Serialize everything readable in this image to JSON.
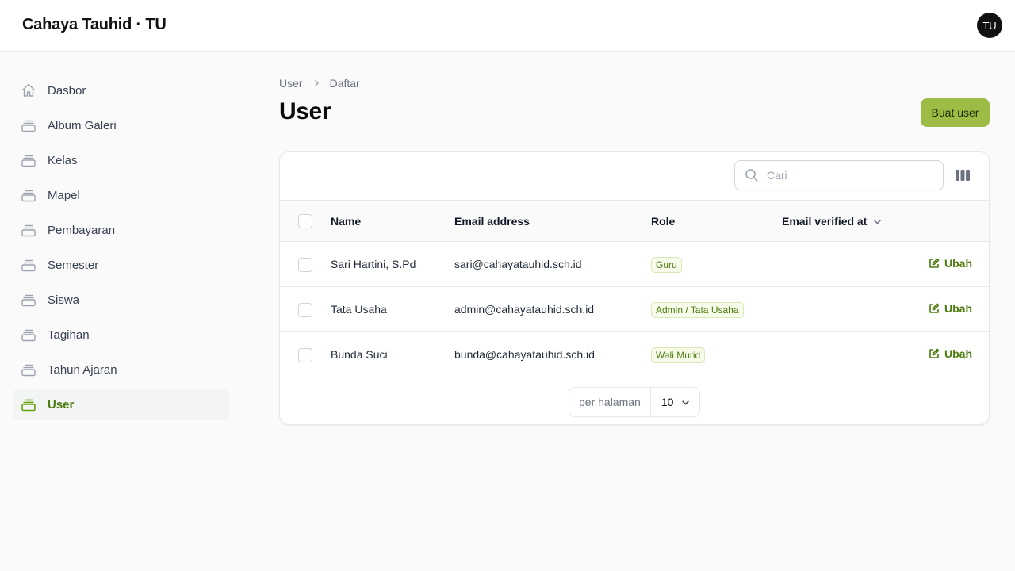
{
  "app": {
    "title": "Cahaya Tauhid · TU",
    "avatar_initials": "TU"
  },
  "colors": {
    "accent": "#9dbc45",
    "accent_text": "#4d7c0f",
    "active_bg": "#f3f4f4"
  },
  "sidebar": {
    "items": [
      {
        "label": "Dasbor",
        "icon": "home-icon",
        "active": false
      },
      {
        "label": "Album Galeri",
        "icon": "stack-icon",
        "active": false
      },
      {
        "label": "Kelas",
        "icon": "stack-icon",
        "active": false
      },
      {
        "label": "Mapel",
        "icon": "stack-icon",
        "active": false
      },
      {
        "label": "Pembayaran",
        "icon": "stack-icon",
        "active": false
      },
      {
        "label": "Semester",
        "icon": "stack-icon",
        "active": false
      },
      {
        "label": "Siswa",
        "icon": "stack-icon",
        "active": false
      },
      {
        "label": "Tagihan",
        "icon": "stack-icon",
        "active": false
      },
      {
        "label": "Tahun Ajaran",
        "icon": "stack-icon",
        "active": false
      },
      {
        "label": "User",
        "icon": "stack-icon",
        "active": true
      }
    ]
  },
  "breadcrumb": {
    "items": [
      "User",
      "Daftar"
    ]
  },
  "page": {
    "title": "User",
    "create_label": "Buat user"
  },
  "table": {
    "search_placeholder": "Cari",
    "columns": {
      "name": "Name",
      "email": "Email address",
      "role": "Role",
      "verified": "Email verified at"
    },
    "rows": [
      {
        "name": "Sari Hartini, S.Pd",
        "email": "sari@cahayatauhid.sch.id",
        "role": "Guru",
        "action": "Ubah"
      },
      {
        "name": "Tata Usaha",
        "email": "admin@cahayatauhid.sch.id",
        "role": "Admin / Tata Usaha",
        "action": "Ubah"
      },
      {
        "name": "Bunda Suci",
        "email": "bunda@cahayatauhid.sch.id",
        "role": "Wali Murid",
        "action": "Ubah"
      }
    ],
    "pagination": {
      "per_page_label": "per halaman",
      "per_page_value": "10"
    }
  }
}
